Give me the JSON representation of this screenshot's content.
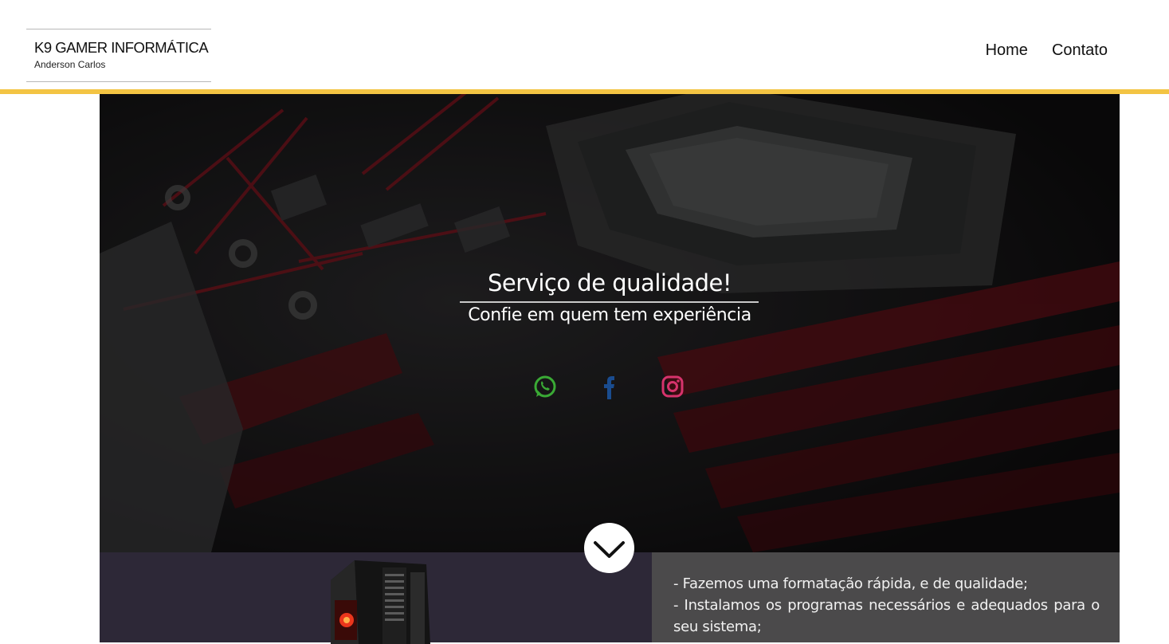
{
  "header": {
    "logo_title": "K9 GAMER INFORMÁTICA",
    "logo_subtitle": "Anderson Carlos",
    "nav": [
      {
        "label": "Home"
      },
      {
        "label": "Contato"
      }
    ],
    "accent_color": "#f3c443"
  },
  "hero": {
    "title": "Serviço de qualidade!",
    "subtitle": "Confie em quem tem experiência",
    "socials": [
      {
        "icon": "whatsapp-icon",
        "color": "#3aaa35"
      },
      {
        "icon": "facebook-icon",
        "color": "#1a4c8f"
      },
      {
        "icon": "instagram-icon",
        "color": "#d6336c"
      }
    ],
    "scroll_icon": "chevron-down-icon"
  },
  "services": {
    "lines": [
      "- Fazemos uma formatação rápida, e de qualidade;",
      "- Instalamos os programas necessários e adequados para o seu sistema;"
    ]
  }
}
